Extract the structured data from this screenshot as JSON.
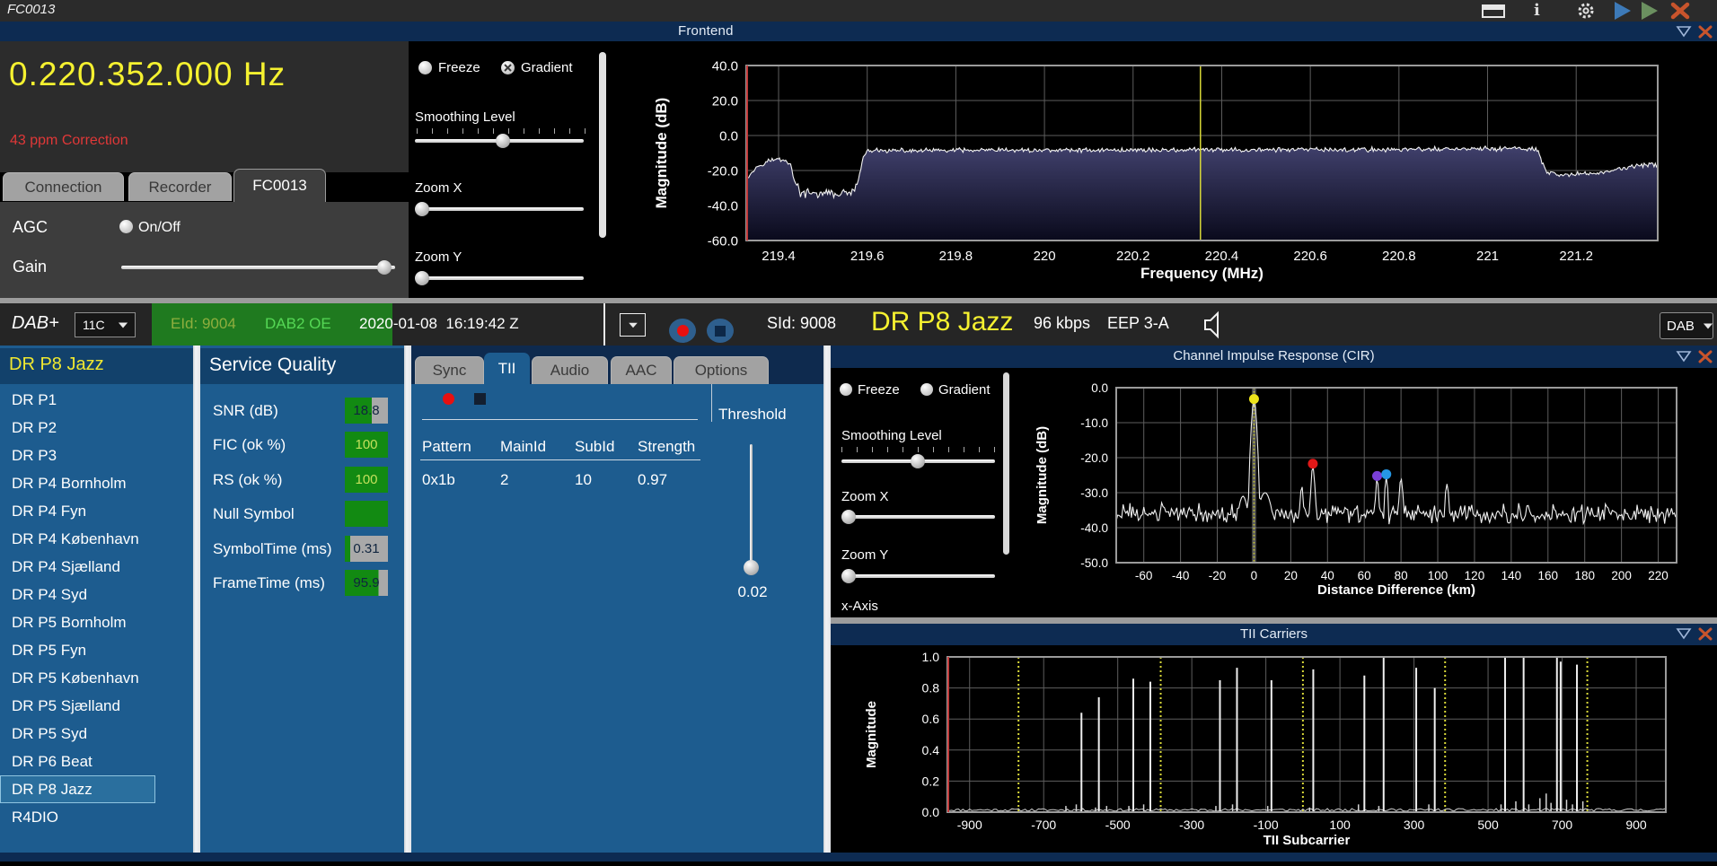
{
  "titlebar": {
    "title": "FC0013"
  },
  "frontend": {
    "panel_title": "Frontend",
    "frequency": "0.220.352.000 Hz",
    "correction": "43 ppm Correction",
    "tabs": [
      "Connection",
      "Recorder",
      "FC0013"
    ],
    "active_tab_index": 2,
    "agc_label": "AGC",
    "agc_radio_label": "On/Off",
    "gain_label": "Gain",
    "display_controls": {
      "freeze": "Freeze",
      "gradient": "Gradient",
      "smoothing": "Smoothing Level",
      "zoom_x": "Zoom X",
      "zoom_y": "Zoom Y"
    }
  },
  "dab_bar": {
    "mode": "DAB+",
    "channel": "11C",
    "eid": "EId: 9004",
    "ensemble": "DAB2 OE",
    "datetime": "2020-01-08  16:19:42 Z",
    "sid": "SId: 9008",
    "service": "DR P8 Jazz",
    "bitrate": "96 kbps",
    "protection": "EEP 3-A",
    "output_mode": "DAB"
  },
  "services": {
    "header": "DR P8 Jazz",
    "selected": "DR P8 Jazz",
    "items": [
      "DR P1",
      "DR P2",
      "DR P3",
      "DR P4 Bornholm",
      "DR P4 Fyn",
      "DR P4 København",
      "DR P4 Sjælland",
      "DR P4 Syd",
      "DR P5 Bornholm",
      "DR P5 Fyn",
      "DR P5 København",
      "DR P5 Sjælland",
      "DR P5 Syd",
      "DR P6 Beat",
      "DR P8 Jazz",
      "R4DIO"
    ]
  },
  "service_quality": {
    "title": "Service Quality",
    "good_color": "#128a12",
    "rest_color": "#a9a9a9",
    "rows": [
      {
        "label": "SNR (dB)",
        "value": "18.8",
        "fill_pct": 62,
        "text_style": "dark"
      },
      {
        "label": "FIC (ok %)",
        "value": "100",
        "fill_pct": 100,
        "text_style": "light"
      },
      {
        "label": "RS (ok %)",
        "value": "100",
        "fill_pct": 100,
        "text_style": "light"
      },
      {
        "label": "Null Symbol",
        "value": "",
        "fill_pct": 100,
        "text_style": "light"
      },
      {
        "label": "SymbolTime (ms)",
        "value": "0.31",
        "fill_pct": 12,
        "text_style": "dark"
      },
      {
        "label": "FrameTime (ms)",
        "value": "95.9",
        "fill_pct": 78,
        "text_style": "dark"
      }
    ]
  },
  "decoder": {
    "tabs": [
      "Sync",
      "TII",
      "Audio",
      "AAC",
      "Options"
    ],
    "active_tab_index": 1,
    "tii_table": {
      "columns": [
        "Pattern",
        "MainId",
        "SubId",
        "Strength"
      ],
      "rows": [
        [
          "0x1b",
          "2",
          "10",
          "0.97"
        ]
      ]
    },
    "threshold_label": "Threshold",
    "threshold_value": "0.02"
  },
  "cir_panel": {
    "title": "Channel Impulse Response (CIR)",
    "controls": {
      "freeze": "Freeze",
      "gradient": "Gradient",
      "smoothing": "Smoothing Level",
      "zoom_x": "Zoom X",
      "zoom_y": "Zoom Y",
      "x_axis": "x-Axis"
    }
  },
  "tii_panel": {
    "title": "TII Carriers"
  },
  "chart_data": [
    {
      "id": "frontend_spectrum",
      "type": "area",
      "title": "Frontend RF spectrum",
      "xlabel": "Frequency (MHz)",
      "ylabel": "Magnitude (dB)",
      "xlim": [
        219.327,
        221.384
      ],
      "ylim": [
        -60,
        40
      ],
      "xticks": [
        [
          219.4,
          "219.4"
        ],
        [
          219.6,
          "219.6"
        ],
        [
          219.8,
          "219.8"
        ],
        [
          220,
          "220"
        ],
        [
          220.2,
          "220.2"
        ],
        [
          220.4,
          "220.4"
        ],
        [
          220.6,
          "220.6"
        ],
        [
          220.8,
          "220.8"
        ],
        [
          221,
          "221"
        ],
        [
          221.2,
          "221.2"
        ]
      ],
      "yticks": [
        [
          40,
          "40.0"
        ],
        [
          20,
          "20.0"
        ],
        [
          0,
          "0.0"
        ],
        [
          -20,
          "-20.0"
        ],
        [
          -40,
          "-40.0"
        ],
        [
          -60,
          "-60.0"
        ]
      ],
      "tuned_marker_mhz": 220.352,
      "envelope": [
        [
          219.327,
          -24
        ],
        [
          219.34,
          -21
        ],
        [
          219.355,
          -17
        ],
        [
          219.375,
          -14.5
        ],
        [
          219.4,
          -13.5
        ],
        [
          219.415,
          -14
        ],
        [
          219.428,
          -17
        ],
        [
          219.436,
          -26
        ],
        [
          219.45,
          -33
        ],
        [
          219.48,
          -33.5
        ],
        [
          219.51,
          -33
        ],
        [
          219.545,
          -33.5
        ],
        [
          219.572,
          -31.5
        ],
        [
          219.582,
          -24
        ],
        [
          219.59,
          -13
        ],
        [
          219.6,
          -8.8
        ],
        [
          219.8,
          -8.5
        ],
        [
          220.1,
          -8.3
        ],
        [
          220.352,
          -8.2
        ],
        [
          220.7,
          -8.1
        ],
        [
          221,
          -7.6
        ],
        [
          221.06,
          -7.4
        ],
        [
          221.112,
          -7.8
        ],
        [
          221.122,
          -15
        ],
        [
          221.132,
          -21
        ],
        [
          221.16,
          -23
        ],
        [
          221.2,
          -22
        ],
        [
          221.25,
          -21.5
        ],
        [
          221.29,
          -19.5
        ],
        [
          221.33,
          -17.5
        ],
        [
          221.384,
          -16.5
        ]
      ],
      "noise_db": 1.6,
      "red_axis_line": true
    },
    {
      "id": "cir",
      "type": "line",
      "title": "Channel Impulse Response (CIR)",
      "xlabel": "Distance Difference (km)",
      "ylabel": "Magnitude (dB)",
      "xlim": [
        -75,
        230
      ],
      "ylim": [
        -50,
        0
      ],
      "xticks": [
        [
          -60,
          "-60"
        ],
        [
          -40,
          "-40"
        ],
        [
          -20,
          "-20"
        ],
        [
          0,
          "0"
        ],
        [
          20,
          "20"
        ],
        [
          40,
          "40"
        ],
        [
          60,
          "60"
        ],
        [
          80,
          "80"
        ],
        [
          100,
          "100"
        ],
        [
          120,
          "120"
        ],
        [
          140,
          "140"
        ],
        [
          160,
          "160"
        ],
        [
          180,
          "180"
        ],
        [
          200,
          "200"
        ],
        [
          220,
          "220"
        ]
      ],
      "yticks": [
        [
          0,
          "0.0"
        ],
        [
          -10,
          "-10.0"
        ],
        [
          -20,
          "-20.0"
        ],
        [
          -30,
          "-30.0"
        ],
        [
          -40,
          "-40.0"
        ],
        [
          -50,
          "-50.0"
        ]
      ],
      "baseline_db": -36,
      "noise_db": 3.2,
      "peaks": [
        {
          "x": -50,
          "y": -32.5,
          "w": 1
        },
        {
          "x": -30,
          "y": -33,
          "w": 1
        },
        {
          "x": -6,
          "y": -31,
          "w": 3
        },
        {
          "x": 0,
          "y": -4,
          "w": 1.4
        },
        {
          "x": 6,
          "y": -30,
          "w": 4
        },
        {
          "x": 26,
          "y": -28,
          "w": 1
        },
        {
          "x": 32,
          "y": -22.5,
          "w": 1.1
        },
        {
          "x": 67,
          "y": -26,
          "w": 1
        },
        {
          "x": 72,
          "y": -25.5,
          "w": 1
        },
        {
          "x": 80,
          "y": -26,
          "w": 1.2
        },
        {
          "x": 105,
          "y": -27.5,
          "w": 1.2
        }
      ],
      "markers": [
        {
          "x": 0,
          "y": -4,
          "color": "#ede41a",
          "name": "main-peak"
        },
        {
          "x": 32,
          "y": -22.5,
          "color": "#e01818",
          "name": "echo-1"
        },
        {
          "x": 67,
          "y": -26,
          "color": "#7a3fd8",
          "name": "echo-2"
        },
        {
          "x": 72,
          "y": -25.5,
          "color": "#2597e4",
          "name": "echo-3"
        }
      ],
      "zero_marker_x": 0
    },
    {
      "id": "tii_carriers",
      "type": "impulse",
      "title": "TII Carriers",
      "xlabel": "TII Subcarrier",
      "ylabel": "Magnitude",
      "xlim": [
        -960,
        980
      ],
      "ylim": [
        0,
        1
      ],
      "xticks": [
        [
          -900,
          "-900"
        ],
        [
          -700,
          "-700"
        ],
        [
          -500,
          "-500"
        ],
        [
          -300,
          "-300"
        ],
        [
          -100,
          "-100"
        ],
        [
          100,
          "100"
        ],
        [
          300,
          "300"
        ],
        [
          500,
          "500"
        ],
        [
          700,
          "700"
        ],
        [
          900,
          "900"
        ]
      ],
      "yticks": [
        [
          1,
          "1.0"
        ],
        [
          0.8,
          "0.8"
        ],
        [
          0.6,
          "0.6"
        ],
        [
          0.4,
          "0.4"
        ],
        [
          0.2,
          "0.2"
        ],
        [
          0,
          "0.0"
        ]
      ],
      "guide_lines_x": [
        -768,
        -384,
        0,
        384,
        768
      ],
      "spikes": [
        [
          -598,
          0.64
        ],
        [
          -551,
          0.74
        ],
        [
          -458,
          0.86
        ],
        [
          -412,
          0.84
        ],
        [
          -224,
          0.85
        ],
        [
          -178,
          0.93
        ],
        [
          -85,
          0.85
        ],
        [
          28,
          0.92
        ],
        [
          166,
          0.88
        ],
        [
          218,
          1.0
        ],
        [
          306,
          0.93
        ],
        [
          356,
          0.8
        ],
        [
          546,
          1.0
        ],
        [
          596,
          1.0
        ],
        [
          686,
          1.0
        ],
        [
          696,
          0.97
        ],
        [
          740,
          0.95
        ]
      ],
      "minor_spikes": [
        [
          -640,
          0.04
        ],
        [
          -612,
          0.05
        ],
        [
          -560,
          0.03
        ],
        [
          -530,
          0.04
        ],
        [
          -470,
          0.04
        ],
        [
          -430,
          0.05
        ],
        [
          -235,
          0.04
        ],
        [
          -190,
          0.05
        ],
        [
          -95,
          0.04
        ],
        [
          18,
          0.03
        ],
        [
          150,
          0.05
        ],
        [
          205,
          0.04
        ],
        [
          340,
          0.05
        ],
        [
          535,
          0.05
        ],
        [
          575,
          0.07
        ],
        [
          610,
          0.05
        ],
        [
          640,
          0.09
        ],
        [
          657,
          0.12
        ],
        [
          670,
          0.06
        ],
        [
          712,
          0.08
        ],
        [
          728,
          0.05
        ],
        [
          756,
          0.07
        ]
      ],
      "red_axis_line": true
    }
  ]
}
